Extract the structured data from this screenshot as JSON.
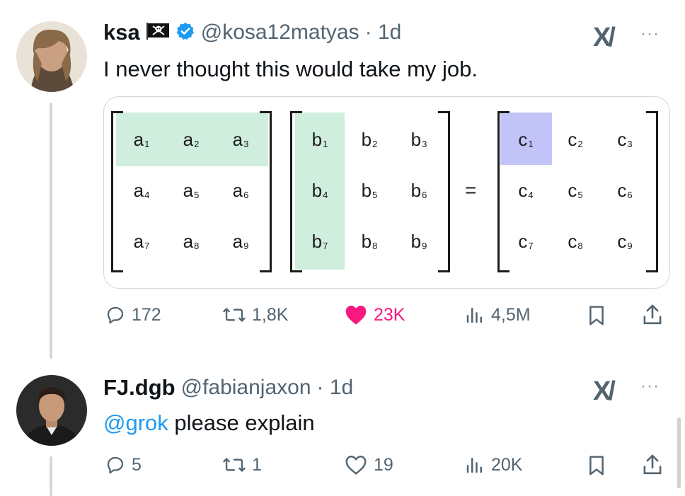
{
  "tweets": [
    {
      "name": "ksa",
      "flag_icon": "pirate-flag-icon",
      "verified_icon": "verified-badge-icon",
      "handle": "@kosa12matyas",
      "time": "· 1d",
      "text": "I never thought this would take my job.",
      "stats": {
        "replies": "172",
        "reposts": "1,8K",
        "likes": "23K",
        "views": "4,5M"
      }
    },
    {
      "name": "FJ.dgb",
      "handle": "@fabianjaxon",
      "time": "· 1d",
      "mention": "@grok",
      "text": " please explain",
      "stats": {
        "replies": "5",
        "reposts": "1",
        "likes": "19",
        "views": "20K"
      }
    }
  ],
  "matrix": {
    "a": [
      [
        "a",
        "1"
      ],
      [
        "a",
        "2"
      ],
      [
        "a",
        "3"
      ],
      [
        "a",
        "4"
      ],
      [
        "a",
        "5"
      ],
      [
        "a",
        "6"
      ],
      [
        "a",
        "7"
      ],
      [
        "a",
        "8"
      ],
      [
        "a",
        "9"
      ]
    ],
    "b": [
      [
        "b",
        "1"
      ],
      [
        "b",
        "2"
      ],
      [
        "b",
        "3"
      ],
      [
        "b",
        "4"
      ],
      [
        "b",
        "5"
      ],
      [
        "b",
        "6"
      ],
      [
        "b",
        "7"
      ],
      [
        "b",
        "8"
      ],
      [
        "b",
        "9"
      ]
    ],
    "c": [
      [
        "c",
        "1"
      ],
      [
        "c",
        "2"
      ],
      [
        "c",
        "3"
      ],
      [
        "c",
        "4"
      ],
      [
        "c",
        "5"
      ],
      [
        "c",
        "6"
      ],
      [
        "c",
        "7"
      ],
      [
        "c",
        "8"
      ],
      [
        "c",
        "9"
      ]
    ],
    "equals": "=",
    "highlight_green": "#cfeedd",
    "highlight_blue": "#c2c4f8"
  },
  "colors": {
    "like_active": "#f91880",
    "link": "#1d9bf0",
    "muted": "#536471"
  },
  "xai_logo": "X/",
  "more_icon": "···"
}
